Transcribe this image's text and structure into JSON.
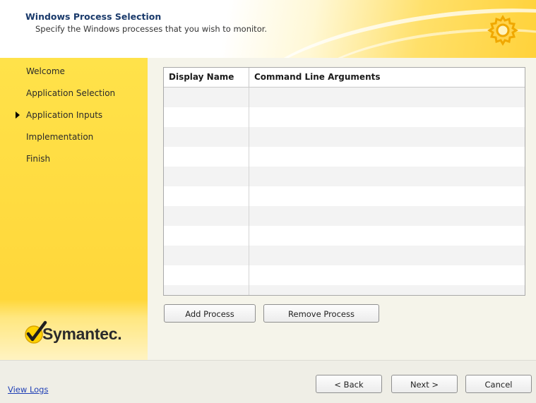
{
  "header": {
    "title": "Windows Process Selection",
    "subtitle": "Specify the Windows processes that you wish to monitor.",
    "icon": "gear-icon"
  },
  "sidebar": {
    "items": [
      {
        "label": "Welcome",
        "active": false
      },
      {
        "label": "Application Selection",
        "active": false
      },
      {
        "label": "Application Inputs",
        "active": true
      },
      {
        "label": "Implementation",
        "active": false
      },
      {
        "label": "Finish",
        "active": false
      }
    ],
    "logo_text": "Symantec.",
    "logo_icon": "checkmark-icon",
    "accent_color": "#ffd73a"
  },
  "grid": {
    "columns": [
      "Display Name",
      "Command Line Arguments"
    ],
    "rows": []
  },
  "buttons": {
    "add_process": "Add Process",
    "remove_process": "Remove Process"
  },
  "footer": {
    "view_logs": "View Logs",
    "back": "< Back",
    "next": "Next >",
    "cancel": "Cancel"
  }
}
